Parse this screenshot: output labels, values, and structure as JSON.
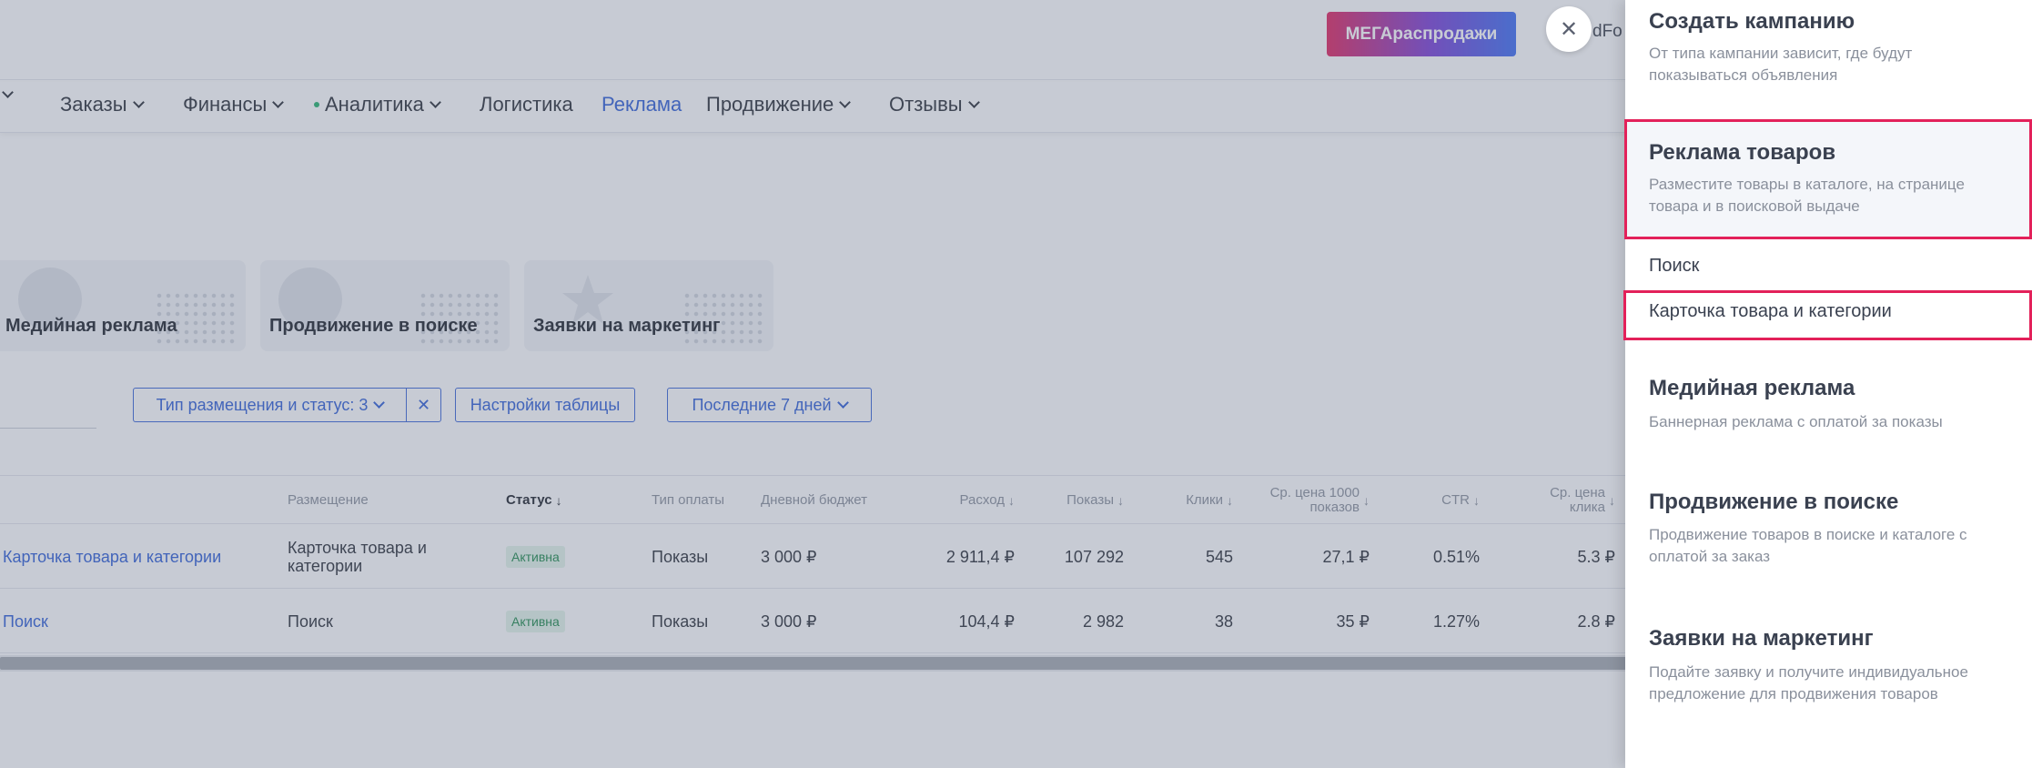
{
  "header": {
    "promo_label": "МЕГАраспродажи",
    "user_fragment": "dFo"
  },
  "nav": {
    "items": [
      {
        "label": "",
        "chevron": true
      },
      {
        "label": "Заказы",
        "chevron": true
      },
      {
        "label": "Финансы",
        "chevron": true
      },
      {
        "label": "Аналитика",
        "chevron": true,
        "dot": true
      },
      {
        "label": "Логистика",
        "chevron": false
      },
      {
        "label": "Реклама",
        "chevron": false,
        "active": true
      },
      {
        "label": "Продвижение",
        "chevron": true
      },
      {
        "label": "Отзывы",
        "chevron": true
      }
    ],
    "active_color": "#2f5fd6"
  },
  "cards": [
    {
      "label": "Медийная реклама"
    },
    {
      "label": "Продвижение в поиске"
    },
    {
      "label": "Заявки на маркетинг"
    }
  ],
  "filters": {
    "placement_status": "Тип размещения и статус: 3",
    "table_settings": "Настройки таблицы",
    "period": "Последние 7 дней"
  },
  "table": {
    "columns": {
      "placement": "Размещение",
      "status": "Статус",
      "payment": "Тип оплаты",
      "budget": "Дневной бюджет",
      "spend": "Расход",
      "impressions": "Показы",
      "clicks": "Клики",
      "cpm_line1": "Ср. цена 1000",
      "cpm_line2": "показов",
      "ctr": "CTR",
      "cpc_line1": "Ср. цена",
      "cpc_line2": "клика"
    },
    "rows": [
      {
        "name": "Карточка товара и категории",
        "placement_line1": "Карточка товара и",
        "placement_line2": "категории",
        "status": "Активна",
        "payment": "Показы",
        "budget": "3 000 ₽",
        "spend": "2 911,4 ₽",
        "impressions": "107 292",
        "clicks": "545",
        "cpm": "27,1 ₽",
        "ctr": "0.51%",
        "cpc": "5.3 ₽"
      },
      {
        "name": "Поиск",
        "placement_line1": "Поиск",
        "placement_line2": "",
        "status": "Активна",
        "payment": "Показы",
        "budget": "3 000 ₽",
        "spend": "104,4 ₽",
        "impressions": "2 982",
        "clicks": "38",
        "cpm": "35 ₽",
        "ctr": "1.27%",
        "cpc": "2.8 ₽"
      }
    ]
  },
  "panel": {
    "create": {
      "title": "Создать кампанию",
      "desc": "От типа кампании зависит, где будут показываться объявления"
    },
    "product_ads": {
      "title": "Реклама товаров",
      "desc": "Разместите товары в каталоге, на странице товара и в поисковой выдаче",
      "options": [
        "Поиск",
        "Карточка товара и категории"
      ]
    },
    "media": {
      "title": "Медийная реклама",
      "desc": "Баннерная реклама с оплатой за показы"
    },
    "search_promo": {
      "title": "Продвижение в поиске",
      "desc": "Продвижение товаров в поиске и каталоге с оплатой за заказ"
    },
    "marketing": {
      "title": "Заявки на маркетинг",
      "desc": "Подайте заявку и получите индивидуальное предложение для продвижения товаров"
    },
    "highlight_color": "#e3215a"
  },
  "icons": {
    "close": "close-icon",
    "chevron": "chevron-down-icon",
    "sort": "arrow-down-icon",
    "clear": "clear-filter-icon"
  }
}
